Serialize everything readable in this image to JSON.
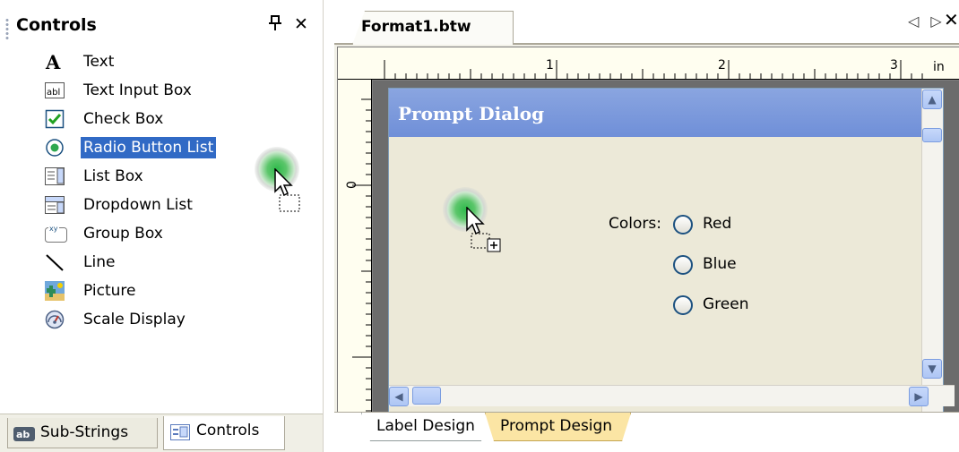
{
  "left_panel": {
    "title": "Controls",
    "pin": "†",
    "close": "✕",
    "items": [
      {
        "label": "Text",
        "icon": "text-A-icon"
      },
      {
        "label": "Text Input Box",
        "icon": "text-input-box-icon"
      },
      {
        "label": "Check Box",
        "icon": "check-box-icon"
      },
      {
        "label": "Radio Button List",
        "icon": "radio-button-icon",
        "selected": true
      },
      {
        "label": "List Box",
        "icon": "list-box-icon"
      },
      {
        "label": "Dropdown List",
        "icon": "dropdown-list-icon"
      },
      {
        "label": "Group Box",
        "icon": "group-box-icon"
      },
      {
        "label": "Line",
        "icon": "line-icon"
      },
      {
        "label": "Picture",
        "icon": "picture-icon"
      },
      {
        "label": "Scale Display",
        "icon": "scale-display-icon"
      }
    ],
    "bottom_tabs": [
      {
        "label": "Sub-Strings",
        "icon": "ab-icon"
      },
      {
        "label": "Controls",
        "icon": "controls-icon",
        "active": true
      }
    ]
  },
  "document": {
    "tab_label": "Format1.btw",
    "nav": "◁ ▷",
    "close": "✕",
    "ruler": {
      "top_numbers": [
        "1",
        "2",
        "3"
      ],
      "unit": "in",
      "left_numbers": [
        "0"
      ]
    },
    "dialog": {
      "title": "Prompt Dialog",
      "colors_label": "Colors:",
      "options": [
        "Red",
        "Blue",
        "Green"
      ]
    },
    "footer_tabs": [
      {
        "label": "Label Design"
      },
      {
        "label": "Prompt Design",
        "active": true
      }
    ]
  },
  "colors": {
    "selection": "#316ac5",
    "dialog_title_bar": "#7b99dc",
    "dialog_body": "#ece9d8",
    "prompt_tab": "#fbe5a4"
  }
}
